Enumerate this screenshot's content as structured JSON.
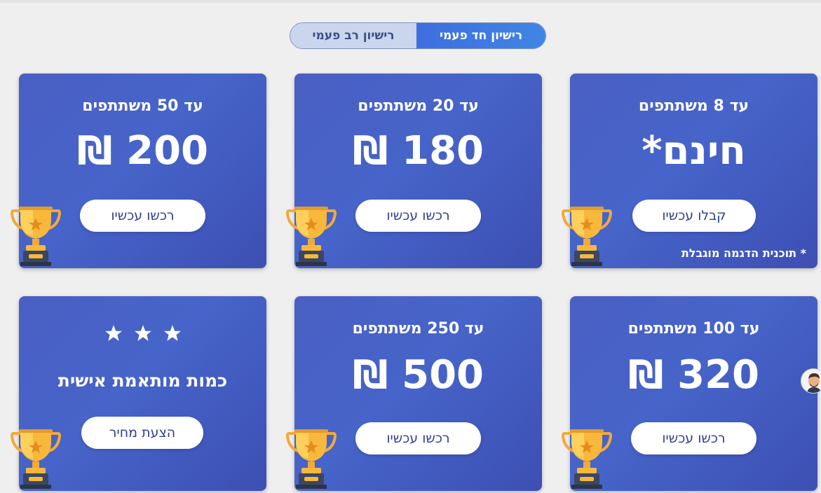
{
  "toggle": {
    "inactive_label": "רישיון רב פעמי",
    "active_label": "רישיון חד פעמי"
  },
  "plans": [
    {
      "participants": "עד 50 משתתפים",
      "price": "200 ₪",
      "button": "רכשו עכשיו"
    },
    {
      "participants": "עד 20 משתתפים",
      "price": "180 ₪",
      "button": "רכשו עכשיו"
    },
    {
      "participants": "עד 8 משתתפים",
      "price": "חינם*",
      "button": "קבלו עכשיו",
      "note": "* תוכנית הדגמה מוגבלת"
    },
    {
      "title": "כמות מותאמת אישית",
      "button": "הצעת מחיר",
      "stars": 3
    },
    {
      "participants": "עד 250 משתתפים",
      "price": "500 ₪",
      "button": "רכשו עכשיו"
    },
    {
      "participants": "עד 100 משתתפים",
      "price": "320 ₪",
      "button": "רכשו עכשיו"
    }
  ],
  "colors": {
    "card_bg": "#4664c9",
    "toggle_active": "#3f7ae2",
    "toggle_inactive": "#c9d6ee",
    "button_text": "#2e3f8f",
    "trophy_gold": "#f7b83b"
  },
  "icons": {
    "trophy": "trophy-icon",
    "star": "star-icon",
    "avatar": "support-agent-avatar"
  }
}
